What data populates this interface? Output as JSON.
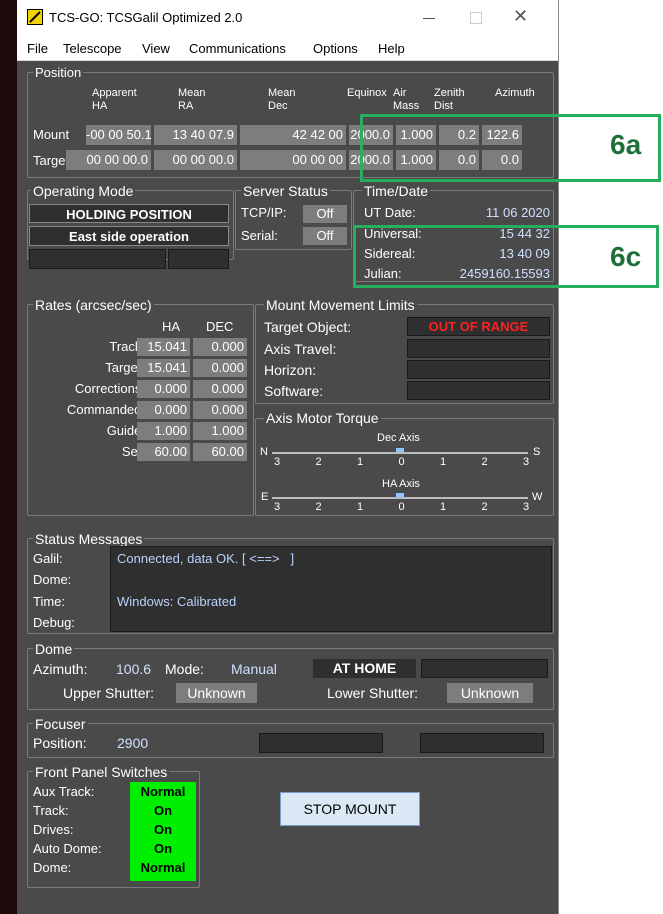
{
  "window": {
    "title": "TCS-GO: TCSGalil Optimized 2.0"
  },
  "menu": [
    "File",
    "Telescope",
    "View",
    "Communications",
    "Options",
    "Help"
  ],
  "position": {
    "title": "Position",
    "headers": {
      "apparent_ha": "Apparent HA",
      "mean_ra": "Mean RA",
      "mean_dec": "Mean Dec",
      "equinox": "Equinox",
      "air_mass": "Air Mass",
      "zenith_dist": "Zenith Dist",
      "azimuth": "Azimuth"
    },
    "mount_label": "Mount",
    "target_label": "Target",
    "mount": [
      "-00 00 50.1",
      "13 40 07.9",
      "42 42 00",
      "2000.0",
      "1.000",
      "0.2",
      "122.6"
    ],
    "target": [
      "00 00 00.0",
      "00 00 00.0",
      "00 00 00",
      "2000.0",
      "1.000",
      "0.0",
      "0.0"
    ]
  },
  "operating_mode": {
    "title": "Operating Mode",
    "line1": "HOLDING POSITION",
    "line2": "East side operation"
  },
  "server_status": {
    "title": "Server Status",
    "tcp_label": "TCP/IP:",
    "tcp_value": "Off",
    "serial_label": "Serial:",
    "serial_value": "Off"
  },
  "time_date": {
    "title": "Time/Date",
    "ut_date_label": "UT Date:",
    "ut_date": "11 06 2020",
    "universal_label": "Universal:",
    "universal": "15 44 32",
    "sidereal_label": "Sidereal:",
    "sidereal": "13 40 09",
    "julian_label": "Julian:",
    "julian": "2459160.15593"
  },
  "rates": {
    "title": "Rates (arcsec/sec)",
    "col_ha": "HA",
    "col_dec": "DEC",
    "rows": [
      {
        "label": "Track:",
        "ha": "15.041",
        "dec": "0.000"
      },
      {
        "label": "Target:",
        "ha": "15.041",
        "dec": "0.000"
      },
      {
        "label": "Corrections:",
        "ha": "0.000",
        "dec": "0.000"
      },
      {
        "label": "Commanded:",
        "ha": "0.000",
        "dec": "0.000"
      },
      {
        "label": "Guide:",
        "ha": "1.000",
        "dec": "1.000"
      },
      {
        "label": "Set:",
        "ha": "60.00",
        "dec": "60.00"
      }
    ]
  },
  "limits": {
    "title": "Mount Movement Limits",
    "target_object_label": "Target Object:",
    "target_object_value": "OUT OF RANGE",
    "axis_travel_label": "Axis Travel:",
    "horizon_label": "Horizon:",
    "software_label": "Software:",
    "alert_color": "#ff2020"
  },
  "torque": {
    "title": "Axis Motor Torque",
    "dec_label": "Dec Axis",
    "ha_label": "HA Axis",
    "dec_left": "N",
    "dec_right": "S",
    "ha_left": "E",
    "ha_right": "W",
    "ticks": [
      "3",
      "2",
      "1",
      "0",
      "1",
      "2",
      "3"
    ],
    "dec_level": 0.0,
    "ha_level": 0.0
  },
  "status": {
    "title": "Status Messages",
    "galil_label": "Galil:",
    "galil": "Connected, data OK. [ <==>   ]",
    "dome_label": "Dome:",
    "dome": "",
    "time_label": "Time:",
    "time": "Windows: Calibrated",
    "debug_label": "Debug:",
    "debug": ""
  },
  "dome": {
    "title": "Dome",
    "azimuth_label": "Azimuth:",
    "azimuth": "100.6",
    "mode_label": "Mode:",
    "mode": "Manual",
    "home": "AT HOME",
    "upper_label": "Upper Shutter:",
    "upper": "Unknown",
    "lower_label": "Lower Shutter:",
    "lower": "Unknown"
  },
  "focuser": {
    "title": "Focuser",
    "position_label": "Position:",
    "position": "2900"
  },
  "switches": {
    "title": "Front Panel Switches",
    "rows": [
      {
        "label": "Aux Track:",
        "value": "Normal"
      },
      {
        "label": "Track:",
        "value": "On"
      },
      {
        "label": "Drives:",
        "value": "On"
      },
      {
        "label": "Auto Dome:",
        "value": "On"
      },
      {
        "label": "Dome:",
        "value": "Normal"
      }
    ],
    "color": "#00ee00"
  },
  "stop_button": "STOP MOUNT",
  "callouts": {
    "a": "6a",
    "c": "6c",
    "color": "#27ae60"
  }
}
